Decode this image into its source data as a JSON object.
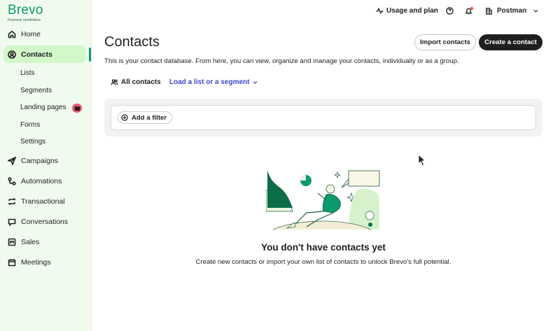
{
  "brand": {
    "name": "Brevo",
    "subtitle": "Formerly sendinblue",
    "color": "#0b996e"
  },
  "sidebar": {
    "items": [
      {
        "label": "Home",
        "icon": "home-icon"
      },
      {
        "label": "Contacts",
        "icon": "user-circle-icon",
        "active": true
      },
      {
        "label": "Campaigns",
        "icon": "send-icon"
      },
      {
        "label": "Automations",
        "icon": "automation-icon"
      },
      {
        "label": "Transactional",
        "icon": "repeat-icon"
      },
      {
        "label": "Conversations",
        "icon": "chat-icon"
      },
      {
        "label": "Sales",
        "icon": "kanban-icon"
      },
      {
        "label": "Meetings",
        "icon": "calendar-icon"
      }
    ],
    "sub_items": [
      {
        "label": "Lists"
      },
      {
        "label": "Segments"
      },
      {
        "label": "Landing pages",
        "badge_icon": "gift-icon"
      },
      {
        "label": "Forms"
      },
      {
        "label": "Settings"
      }
    ]
  },
  "topbar": {
    "usage_label": "Usage and plan",
    "account_label": "Postman"
  },
  "main": {
    "title": "Contacts",
    "description": "This is your contact database. From here, you can view, organize and manage your contacts, individually or as a group.",
    "import_button": "Import contacts",
    "create_button": "Create a contact",
    "tab_all": "All contacts",
    "tab_load": "Load a list or a segment",
    "add_filter": "Add a filter",
    "empty_title": "You don't have contacts yet",
    "empty_desc": "Create new contacts or import your own list of contacts to unlock Brevo's full potential."
  },
  "colors": {
    "accent": "#0b996e",
    "sidebar_bg": "#f0fbee",
    "active_bg": "#d2f7c8",
    "link": "#3b48c9",
    "dark_button": "#1f1f1f"
  }
}
